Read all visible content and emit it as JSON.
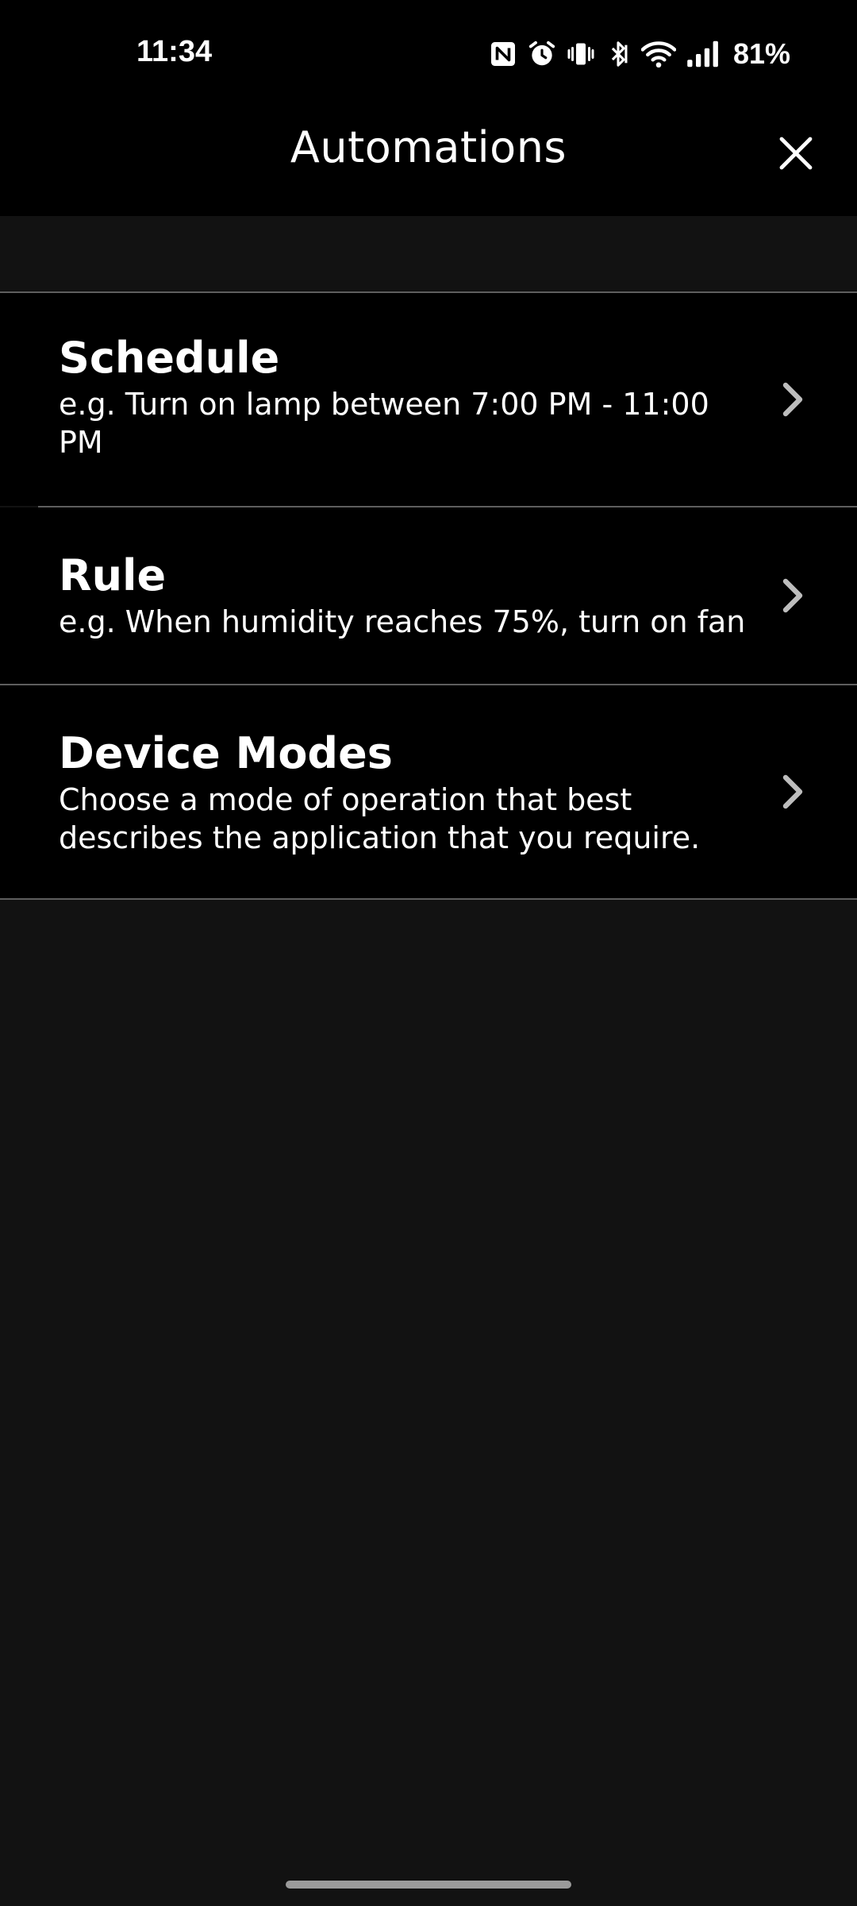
{
  "status_bar": {
    "time": "11:34",
    "battery": "81%",
    "icons": [
      "nfc-icon",
      "alarm-icon",
      "vibrate-icon",
      "bluetooth-icon",
      "wifi-icon",
      "signal-icon"
    ]
  },
  "app_bar": {
    "title": "Automations",
    "close_icon": "close-icon"
  },
  "items": [
    {
      "title": "Schedule",
      "description": "e.g. Turn on lamp between 7:00 PM - 11:00 PM"
    },
    {
      "title": "Rule",
      "description": "e.g. When humidity reaches 75%, turn on fan"
    },
    {
      "title": "Device Modes",
      "description": "Choose a mode of operation that best describes the application that you require."
    }
  ],
  "colors": {
    "background": "#121212",
    "surface": "#000000",
    "divider": "#5e5e5e",
    "text": "#ffffff",
    "chevron": "#bdbdbd"
  }
}
